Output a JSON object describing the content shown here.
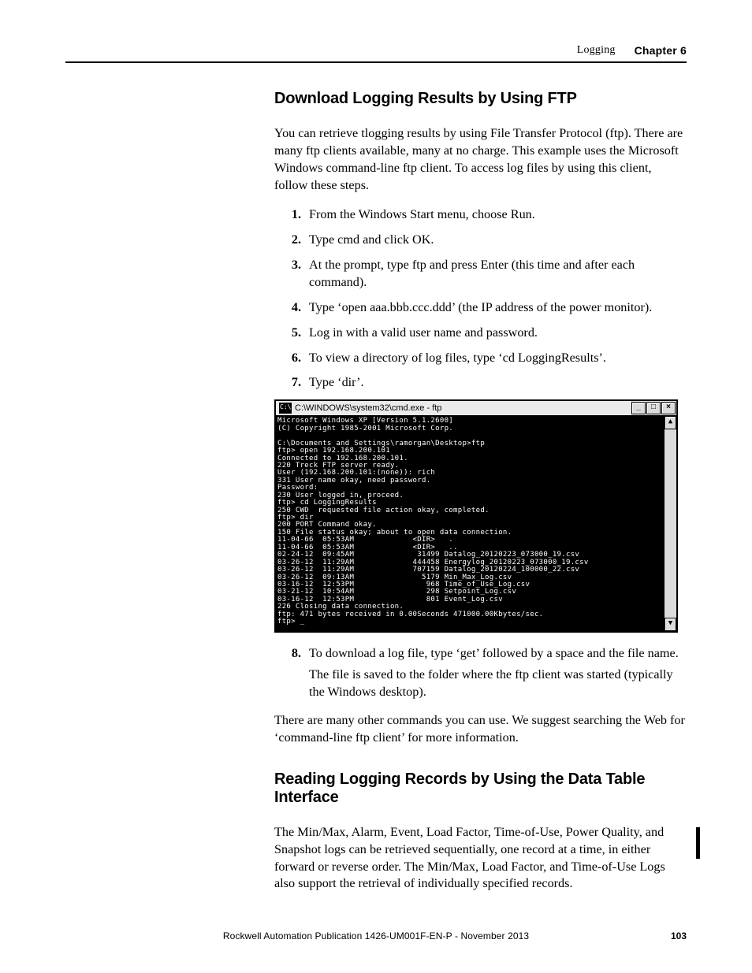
{
  "header": {
    "topic": "Logging",
    "chapter": "Chapter 6"
  },
  "section1": {
    "title": "Download Logging Results by Using FTP",
    "intro": "You can retrieve tlogging results by using File Transfer Protocol (ftp). There are many ftp clients available, many at no charge. This example uses the Microsoft Windows command-line ftp client. To access log files by using this client, follow these steps.",
    "steps_a": [
      "From the Windows Start menu, choose Run.",
      "Type cmd and click OK.",
      "At the prompt, type ftp and press Enter (this time and after each command).",
      "Type ‘open aaa.bbb.ccc.ddd’ (the IP address of the power monitor).",
      "Log in with a valid user name and password.",
      "To view a directory of log files, type ‘cd LoggingResults’.",
      "Type ‘dir’."
    ],
    "step8": "To download a log file, type ‘get’ followed by a space and the file name.",
    "step8_note": "The file is saved to the folder where the ftp client was started (typically the Windows desktop).",
    "outro": "There are many other commands you can use. We suggest searching the Web for ‘command-line ftp client’ for more information."
  },
  "cmd": {
    "title": "C:\\WINDOWS\\system32\\cmd.exe - ftp",
    "min_glyph": "_",
    "max_glyph": "□",
    "close_glyph": "×",
    "scroll_up": "▲",
    "scroll_down": "▼",
    "text": "Microsoft Windows XP [Version 5.1.2600]\n(C) Copyright 1985-2001 Microsoft Corp.\n\nC:\\Documents and Settings\\ramorgan\\Desktop>ftp\nftp> open 192.168.200.101\nConnected to 192.168.200.101.\n220 Treck FTP server ready.\nUser (192.168.200.101:(none)): rich\n331 User name okay, need password.\nPassword:\n230 User logged in, proceed.\nftp> cd LoggingResults\n250 CWD  requested file action okay, completed.\nftp> dir\n200 PORT Command okay.\n150 File status okay; about to open data connection.\n11-04-66  05:53AM             <DIR>   .\n11-04-66  05:53AM             <DIR>   ..\n02-24-12  09:45AM              31499 Datalog_20120223_073000_19.csv\n03-26-12  11:29AM             444458 Energylog_20120223_073000_19.csv\n03-26-12  11:29AM             707159 Datalog_20120224_100000_22.csv\n03-26-12  09:13AM               5179 Min_Max_Log.csv\n03-16-12  12:53PM                968 Time_of_Use_Log.csv\n03-21-12  10:54AM                298 Setpoint_Log.csv\n03-16-12  12:53PM                801 Event_Log.csv\n226 Closing data connection.\nftp: 471 bytes received in 0.00Seconds 471000.00Kbytes/sec.\nftp> _"
  },
  "section2": {
    "title": "Reading Logging Records by Using the Data Table Interface",
    "body": "The Min/Max, Alarm, Event, Load Factor, Time-of-Use, Power Quality, and Snapshot logs can be retrieved sequentially, one record at a time, in either forward or reverse order. The Min/Max, Load Factor, and Time-of-Use Logs also support the retrieval of individually specified records."
  },
  "footer": {
    "publication": "Rockwell Automation Publication 1426-UM001F-EN-P - November 2013",
    "page": "103"
  }
}
